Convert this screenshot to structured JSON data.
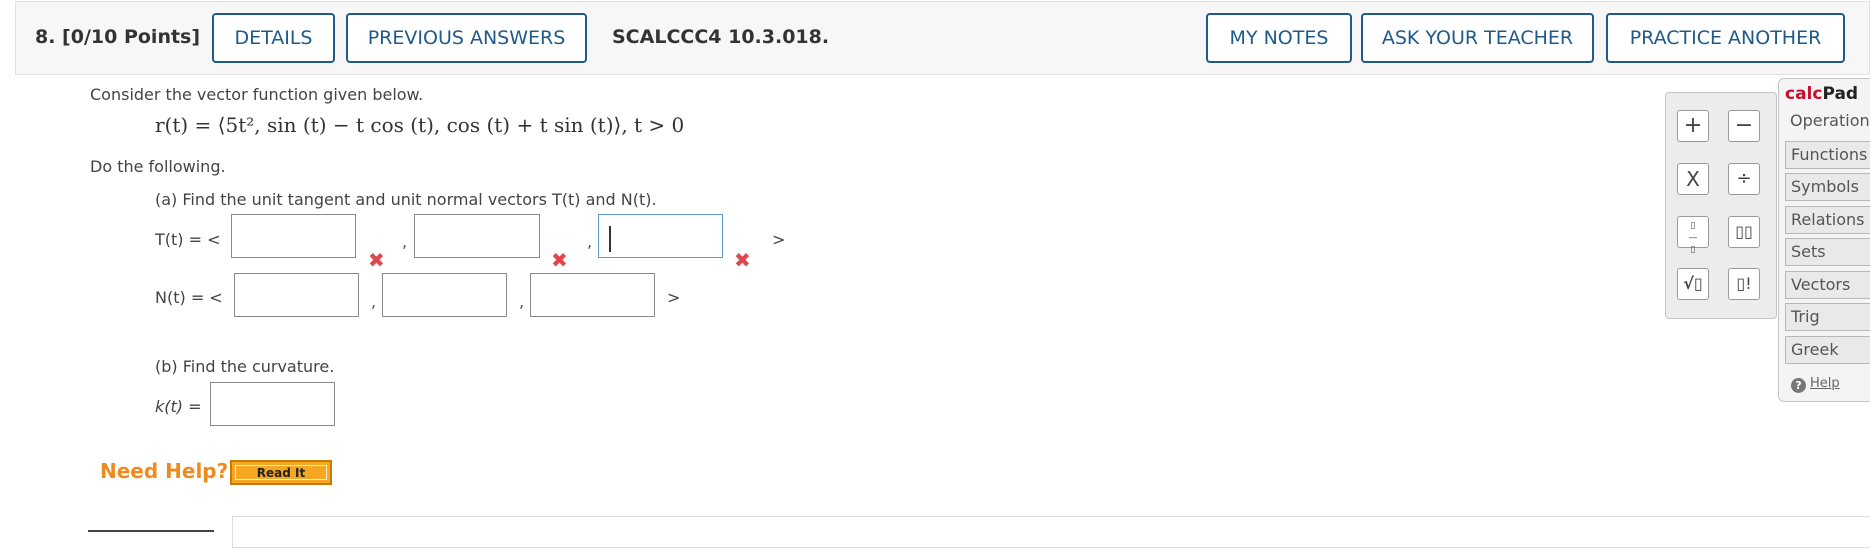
{
  "header": {
    "question_number": "8.  [0/10 Points]",
    "details_label": "DETAILS",
    "previous_answers_label": "PREVIOUS ANSWERS",
    "question_ref": "SCALCCC4 10.3.018.",
    "my_notes_label": "MY NOTES",
    "ask_teacher_label": "ASK YOUR TEACHER",
    "practice_another_label": "PRACTICE ANOTHER"
  },
  "problem": {
    "intro": "Consider the vector function given below.",
    "equation": "r(t) = ⟨5t², sin (t) − t cos (t), cos (t) + t sin (t)⟩, t > 0",
    "instruction": "Do the following.",
    "part_a": "(a) Find the unit tangent and unit normal vectors T(t) and N(t).",
    "T_label": "T(t) = <",
    "N_label": "N(t) = <",
    "close_bracket": ">",
    "comma": ",",
    "part_b": "(b) Find the curvature.",
    "k_label": "k(t) ="
  },
  "answers": {
    "T": [
      "",
      "",
      ""
    ],
    "N": [
      "",
      "",
      ""
    ],
    "k": ""
  },
  "help": {
    "need_help": "Need Help?",
    "read_it": "Read It"
  },
  "calcpad": {
    "title_red": "calc",
    "title_black": "Pad",
    "keys": [
      "+",
      "−",
      "X",
      "÷",
      "▯/▯",
      "▯▯",
      "√▯",
      "▯!"
    ],
    "tabs": [
      "Operations",
      "Functions",
      "Symbols",
      "Relations",
      "Sets",
      "Vectors",
      "Trig",
      "Greek"
    ],
    "help_label": "Help"
  },
  "colors": {
    "accent": "#1f5a8a",
    "error": "#e0474c",
    "help_orange": "#f08a1a",
    "calc_red": "#c8102e"
  }
}
